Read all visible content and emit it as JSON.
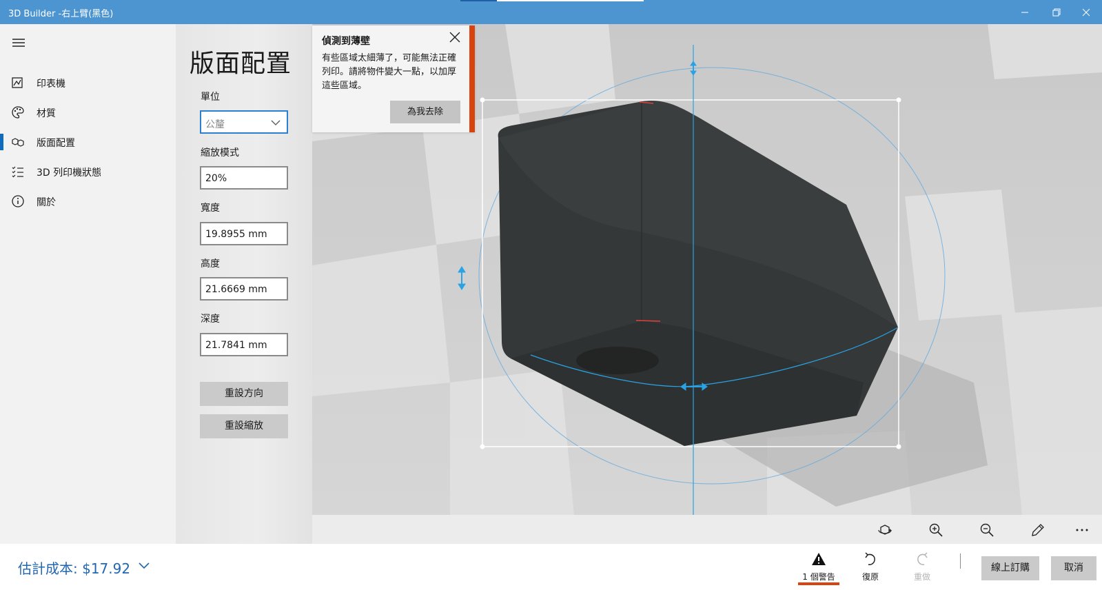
{
  "window": {
    "title": "3D Builder -右上臂(黑色)",
    "progress": 0.2,
    "minimize_icon": "minimize-icon",
    "maximize_icon": "restore-icon",
    "close_icon": "close-icon"
  },
  "nav": {
    "items": [
      {
        "label": "印表機",
        "icon": "printer-icon",
        "active": false
      },
      {
        "label": "材質",
        "icon": "palette-icon",
        "active": false
      },
      {
        "label": "版面配置",
        "icon": "layout-cubes-icon",
        "active": true
      },
      {
        "label": "3D 列印機狀態",
        "icon": "checklist-icon",
        "active": false
      },
      {
        "label": "關於",
        "icon": "info-icon",
        "active": false
      }
    ]
  },
  "settings": {
    "title": "版面配置",
    "unit_label": "單位",
    "unit_value": "公釐",
    "scale_mode_label": "縮放模式",
    "scale_mode_value": "20%",
    "width_label": "寬度",
    "width_value": "19.8955 mm",
    "height_label": "高度",
    "height_value": "21.6669 mm",
    "depth_label": "深度",
    "depth_value": "21.7841 mm",
    "reset_orientation": "重設方向",
    "reset_scale": "重設縮放"
  },
  "notice": {
    "title": "偵測到薄壁",
    "body": "有些區域太細薄了，可能無法正確列印。請將物件變大一點，以加厚這些區域。",
    "button": "為我去除",
    "accent_color": "#d9430f"
  },
  "toolbar": {
    "icons": [
      "rotate-view-icon",
      "zoom-in-icon",
      "zoom-out-icon",
      "pencil-icon",
      "more-icon"
    ]
  },
  "bottom": {
    "cost": "估計成本: $17.92",
    "warnings_label": "1 個警告",
    "undo_label": "復原",
    "redo_label": "重做",
    "order_label": "線上訂購",
    "cancel_label": "取消"
  },
  "colors": {
    "titlebar": "#4c95d1",
    "accent": "#0f6cbd",
    "model": "#3a3d3d",
    "gizmo": "#29a3e6"
  }
}
